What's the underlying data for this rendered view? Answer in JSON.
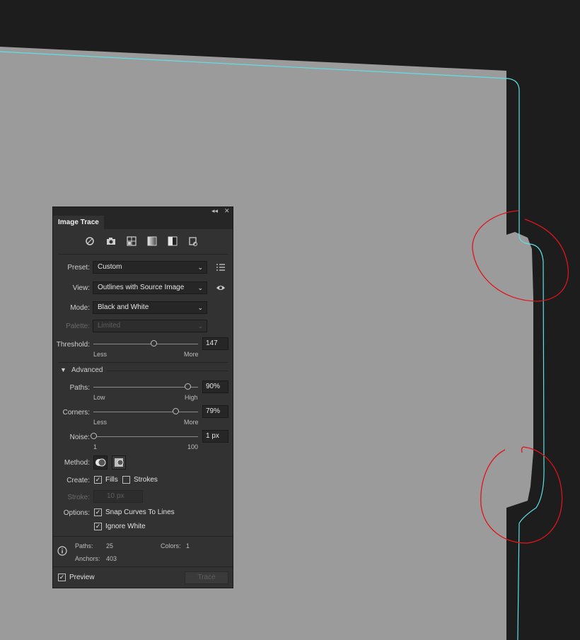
{
  "panel": {
    "tab_title": "Image Trace",
    "collapse_glyph": "◂◂",
    "close_glyph": "✕",
    "icons": [
      "auto-color-icon",
      "high-color-camera-icon",
      "low-color-icon",
      "grayscale-icon",
      "black-white-icon",
      "outline-icon"
    ],
    "preset": {
      "label": "Preset:",
      "value": "Custom"
    },
    "view": {
      "label": "View:",
      "value": "Outlines with Source Image"
    },
    "mode": {
      "label": "Mode:",
      "value": "Black and White"
    },
    "palette": {
      "label": "Palette:",
      "value": "Limited"
    },
    "threshold": {
      "label": "Threshold:",
      "value": "147",
      "level": 147,
      "min_label": "Less",
      "max_label": "More"
    },
    "advanced": {
      "label": "Advanced"
    },
    "paths": {
      "label": "Paths:",
      "value": "90%",
      "level": 90,
      "min_label": "Low",
      "max_label": "High"
    },
    "corners": {
      "label": "Corners:",
      "value": "79%",
      "level": 79,
      "min_label": "Less",
      "max_label": "More"
    },
    "noise": {
      "label": "Noise:",
      "value": "1 px",
      "level": 1,
      "min_label": "1",
      "max_label": "100"
    },
    "method": {
      "label": "Method:"
    },
    "create": {
      "label": "Create:",
      "fills": "Fills",
      "strokes": "Strokes",
      "fills_checked": true,
      "strokes_checked": false
    },
    "stroke": {
      "label": "Stroke:",
      "value": "10 px"
    },
    "options": {
      "label": "Options:",
      "snap": "Snap Curves To Lines",
      "ignore_white": "Ignore White",
      "snap_checked": true,
      "ignore_checked": true
    },
    "info": {
      "paths_label": "Paths:",
      "paths_value": "25",
      "colors_label": "Colors:",
      "colors_value": "1",
      "anchors_label": "Anchors:",
      "anchors_value": "403"
    },
    "preview": {
      "label": "Preview",
      "checked": true
    },
    "trace_button": "Trace"
  },
  "colors": {
    "accent_outline": "#5ee0e6",
    "annotation": "#e0141b",
    "shape": "#9b9b9b",
    "background": "#1d1d1d"
  }
}
